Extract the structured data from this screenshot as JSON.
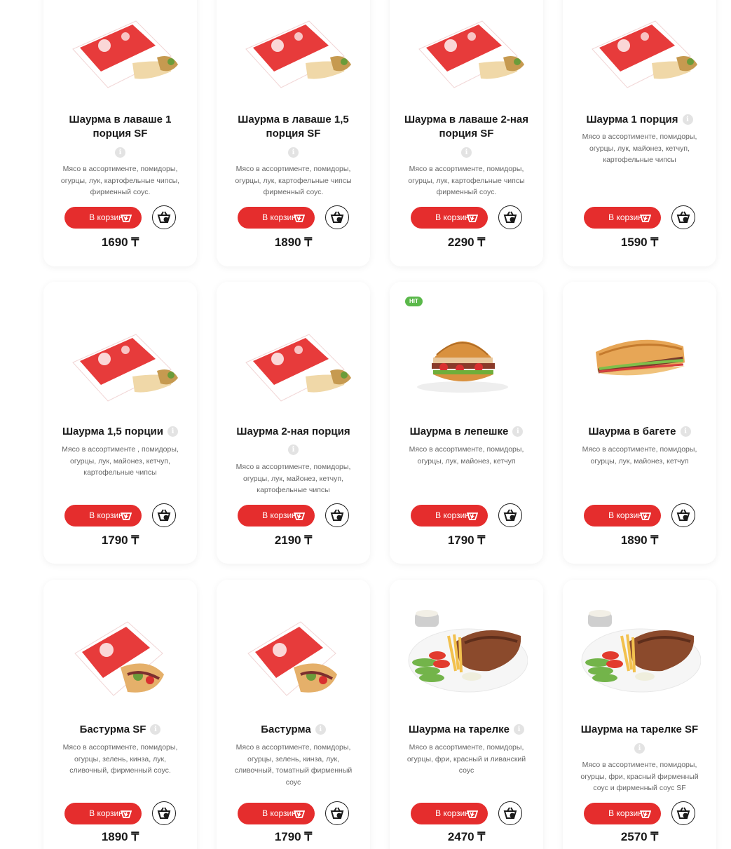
{
  "currency": "₸",
  "add_label": "В корзину",
  "products": [
    {
      "title": "Шаурма в лаваше 1 порция SF",
      "desc": "Мясо в ассортименте, помидоры, огурцы, лук, картофельные чипсы, фирменный соус.",
      "price": "1690 ₸",
      "image": "wrap-image",
      "badge": ""
    },
    {
      "title": "Шаурма в лаваше 1,5 порция SF",
      "desc": "Мясо в ассортименте, помидоры, огурцы, лук, картофельные чипсы фирменный соус.",
      "price": "1890 ₸",
      "image": "wrap-image",
      "badge": ""
    },
    {
      "title": "Шаурма в лаваше 2-ная порция SF",
      "desc": "Мясо в ассортименте, помидоры, огурцы, лук, картофельные чипсы фирменный соус.",
      "price": "2290 ₸",
      "image": "wrap-image",
      "badge": ""
    },
    {
      "title": "Шаурма 1 порция",
      "desc": "Мясо в ассортименте, помидоры, огурцы, лук, майонез, кетчуп, картофельные чипсы",
      "price": "1590 ₸",
      "image": "wrap-image",
      "badge": ""
    },
    {
      "title": "Шаурма 1,5 порции",
      "desc": "Мясо в ассортименте , помидоры, огурцы, лук, майонез, кетчуп, картофельные чипсы",
      "price": "1790 ₸",
      "image": "wrap-image",
      "badge": ""
    },
    {
      "title": "Шаурма 2-ная порция",
      "desc": "Мясо в ассортименте, помидоры, огурцы, лук, майонез, кетчуп, картофельные чипсы",
      "price": "2190 ₸",
      "image": "wrap-image",
      "badge": ""
    },
    {
      "title": "Шаурма в лепешке",
      "desc": "Мясо в ассортименте, помидоры, огурцы, лук, майонез, кетчуп",
      "price": "1790 ₸",
      "image": "flatbread-image",
      "badge": "HIT"
    },
    {
      "title": "Шаурма в багете",
      "desc": "Мясо в ассортименте, помидоры, огурцы, лук, майонез, кетчуп",
      "price": "1890 ₸",
      "image": "baguette-image",
      "badge": ""
    },
    {
      "title": "Бастурма SF",
      "desc": "Мясо в ассортименте, помидоры, огурцы, зелень, кинза, лук, сливочный, фирменный соус.",
      "price": "1890 ₸",
      "image": "basturma-image",
      "badge": ""
    },
    {
      "title": "Бастурма",
      "desc": "Мясо в ассортименте, помидоры, огурцы, зелень, кинза, лук, сливочный, томатный фирменный соус",
      "price": "1790 ₸",
      "image": "basturma-image",
      "badge": ""
    },
    {
      "title": "Шаурма на тарелке",
      "desc": "Мясо в ассортименте, помидоры, огурцы, фри, красный и ливанский соус",
      "price": "2470 ₸",
      "image": "plate-image",
      "badge": ""
    },
    {
      "title": "Шаурма на тарелке SF",
      "desc": "Мясо в ассортименте, помидоры, огурцы, фри, красный фирменный соус и фирменный соус SF",
      "price": "2570 ₸",
      "image": "plate-image",
      "badge": ""
    }
  ],
  "colors": {
    "accent": "#e52d2d",
    "hit": "#5ab84a"
  }
}
